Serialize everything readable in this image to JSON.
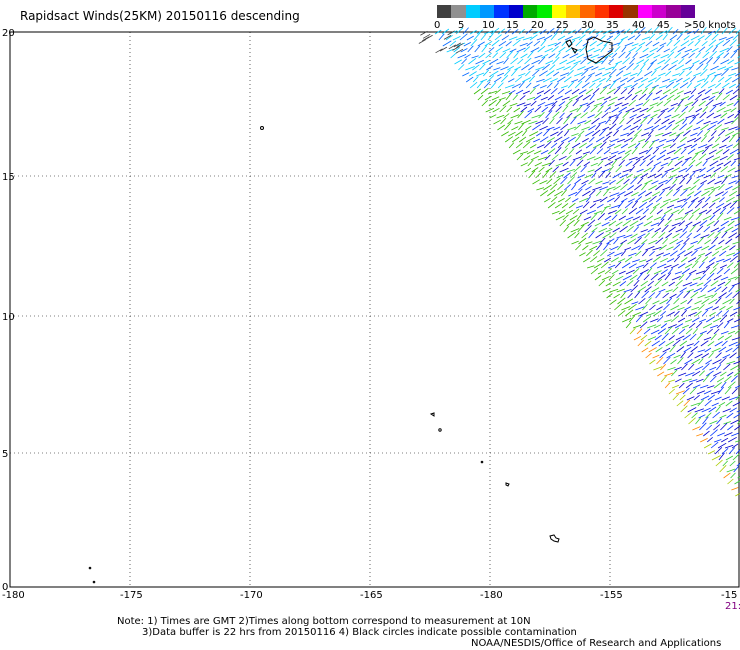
{
  "title": "Rapidsact Winds(25KM) 20150116 descending",
  "colorbar": {
    "colors": [
      "#404040",
      "#909090",
      "#00ccff",
      "#0099ff",
      "#0033ff",
      "#0000cc",
      "#00aa00",
      "#00ee00",
      "#ffff00",
      "#ffbb00",
      "#ff6600",
      "#ff3300",
      "#dd0000",
      "#993300",
      "#ff00ff",
      "#cc00cc",
      "#990099",
      "#660099"
    ],
    "labels": [
      "0",
      "5",
      "10",
      "15",
      "20",
      "25",
      "30",
      "35",
      "40",
      "45",
      ">50 knots"
    ]
  },
  "y_ticks": [
    "20",
    "15",
    "10",
    "5",
    "0"
  ],
  "x_ticks": [
    "-180",
    "-175",
    "-170",
    "-165",
    "-180",
    "-155",
    "-15"
  ],
  "time_stamp": "21:",
  "notes": [
    "Note: 1) Times are GMT 2)Times along bottom correspond to measurement at 10N",
    "3)Data buffer is 22 hrs from 20150116 4) Black circles indicate possible contamination",
    "NOAA/NESDIS/Office of Research and Applications"
  ],
  "legend_units": "knots"
}
